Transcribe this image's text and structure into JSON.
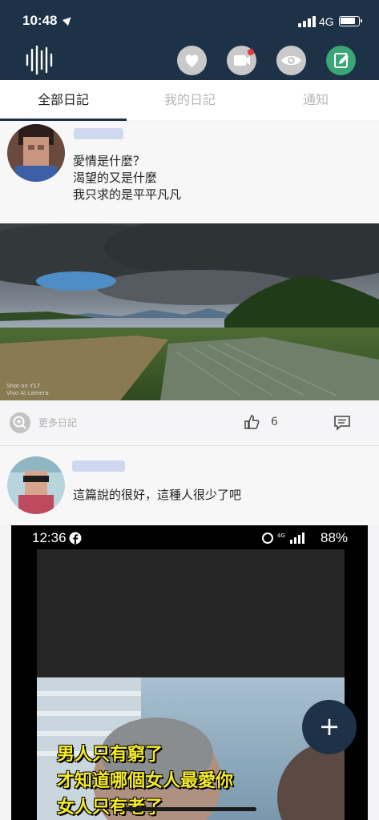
{
  "status_bar": {
    "time": "10:48",
    "network": "4G"
  },
  "header": {
    "icons": [
      "logo-waveform-icon",
      "heart-icon",
      "video-icon",
      "eye-icon",
      "edit-icon"
    ]
  },
  "tabs": [
    {
      "label": "全部日記",
      "active": true
    },
    {
      "label": "我的日記",
      "active": false
    },
    {
      "label": "通知",
      "active": false
    }
  ],
  "posts": [
    {
      "text": "愛情是什麼？\n渴望的又是什麼\n我只求的是平平凡凡",
      "photo_watermark": "Shot on Y17\nVivo AI camera",
      "more_label": "更多日記",
      "like_count": "6"
    },
    {
      "text": "這篇說的很好，這種人很少了吧",
      "screenshot": {
        "time": "12:36",
        "battery": "88%",
        "caption_lines": [
          "男人只有窮了",
          "才知道哪個女人最愛你",
          "女人只有老了"
        ]
      }
    }
  ],
  "fab_label": "+",
  "colors": {
    "header_bg": "#1e3247",
    "accent": "#1e3247",
    "notification_dot": "#e23a3a",
    "edit_button": "#3aa676"
  }
}
